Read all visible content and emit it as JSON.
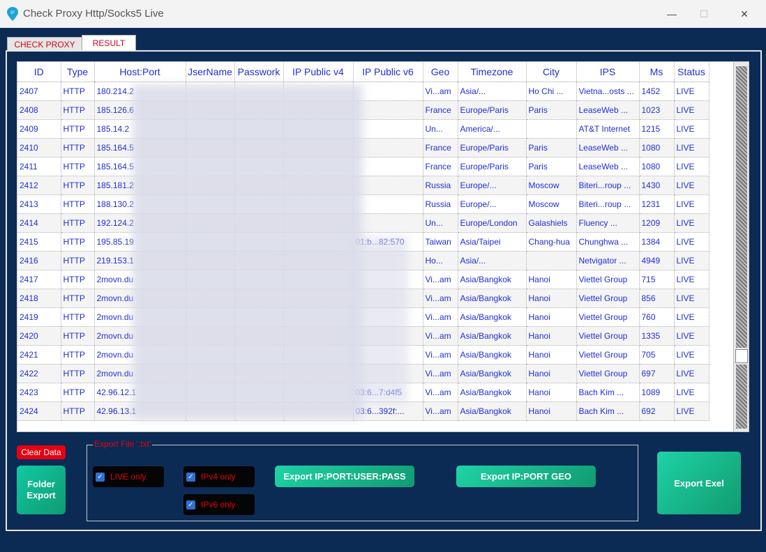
{
  "window": {
    "title": "Check Proxy Http/Socks5 Live",
    "icon": "location-pin-icon",
    "minimize": "—",
    "maximize": "☐",
    "close": "✕"
  },
  "tabs": [
    {
      "label": "CHECK PROXY"
    },
    {
      "label": "RESULT",
      "active": true
    }
  ],
  "table": {
    "columns": [
      "ID",
      "Type",
      "Host:Port",
      "JserName",
      "Passwork",
      "IP Public v4",
      "IP Public v6",
      "Geo",
      "Timezone",
      "City",
      "IPS",
      "Ms",
      "Status"
    ],
    "rows": [
      [
        "2407",
        "HTTP",
        "180.214.2",
        "",
        "",
        "",
        "",
        "Vi...am",
        "Asia/...",
        "Ho Chi ...",
        "Vietna...osts ...",
        "1452",
        "LIVE"
      ],
      [
        "2408",
        "HTTP",
        "185.126.6",
        "",
        "",
        "",
        "",
        "France",
        "Europe/Paris",
        "Paris",
        "LeaseWeb ...",
        "1023",
        "LIVE"
      ],
      [
        "2409",
        "HTTP",
        "185.14.2",
        "",
        "",
        "",
        "",
        "Un...",
        "America/...",
        "",
        "AT&T Internet",
        "1215",
        "LIVE"
      ],
      [
        "2410",
        "HTTP",
        "185.164.5",
        "",
        "",
        "",
        "",
        "France",
        "Europe/Paris",
        "Paris",
        "LeaseWeb ...",
        "1080",
        "LIVE"
      ],
      [
        "2411",
        "HTTP",
        "185.164.5",
        "",
        "",
        "",
        "",
        "France",
        "Europe/Paris",
        "Paris",
        "LeaseWeb ...",
        "1080",
        "LIVE"
      ],
      [
        "2412",
        "HTTP",
        "185.181.2",
        "",
        "",
        "",
        "",
        "Russia",
        "Europe/...",
        "Moscow",
        "Biteri...roup ...",
        "1430",
        "LIVE"
      ],
      [
        "2413",
        "HTTP",
        "188.130.2",
        "",
        "",
        "",
        "",
        "Russia",
        "Europe/...",
        "Moscow",
        "Biteri...roup ...",
        "1231",
        "LIVE"
      ],
      [
        "2414",
        "HTTP",
        "192.124.2",
        "",
        "",
        "",
        "",
        "Un...",
        "Europe/London",
        "Galashiels",
        "Fluency ...",
        "1209",
        "LIVE"
      ],
      [
        "2415",
        "HTTP",
        "195.85.19",
        "",
        "",
        "",
        "01:b...82:570",
        "Taiwan",
        "Asia/Taipei",
        "Chang-hua",
        "Chunghwa ...",
        "1384",
        "LIVE"
      ],
      [
        "2416",
        "HTTP",
        "219.153.1",
        "",
        "",
        "",
        "",
        "Ho...",
        "Asia/...",
        "",
        "Netvigator ...",
        "4949",
        "LIVE"
      ],
      [
        "2417",
        "HTTP",
        "2movn.du",
        "",
        "",
        "",
        "",
        "Vi...am",
        "Asia/Bangkok",
        "Hanoi",
        "Viettel Group",
        "715",
        "LIVE"
      ],
      [
        "2418",
        "HTTP",
        "2movn.du",
        "",
        "",
        "",
        "",
        "Vi...am",
        "Asia/Bangkok",
        "Hanoi",
        "Viettel Group",
        "856",
        "LIVE"
      ],
      [
        "2419",
        "HTTP",
        "2movn.du",
        "",
        "",
        "",
        "",
        "Vi...am",
        "Asia/Bangkok",
        "Hanoi",
        "Viettel Group",
        "760",
        "LIVE"
      ],
      [
        "2420",
        "HTTP",
        "2movn.du",
        "",
        "",
        "",
        "",
        "Vi...am",
        "Asia/Bangkok",
        "Hanoi",
        "Viettel Group",
        "1335",
        "LIVE"
      ],
      [
        "2421",
        "HTTP",
        "2movn.du",
        "",
        "",
        "",
        "",
        "Vi...am",
        "Asia/Bangkok",
        "Hanoi",
        "Viettel Group",
        "705",
        "LIVE"
      ],
      [
        "2422",
        "HTTP",
        "2movn.du",
        "",
        "",
        "",
        "",
        "Vi...am",
        "Asia/Bangkok",
        "Hanoi",
        "Viettel Group",
        "697",
        "LIVE"
      ],
      [
        "2423",
        "HTTP",
        "42.96.12.1",
        "",
        "",
        "",
        "03:6...7:d4f5",
        "Vi...am",
        "Asia/Bangkok",
        "Hanoi",
        "Bach Kim ...",
        "1089",
        "LIVE"
      ],
      [
        "2424",
        "HTTP",
        "42.96.13.1",
        "",
        "",
        "",
        "03:6...392f:...",
        "Vi...am",
        "Asia/Bangkok",
        "Hanoi",
        "Bach Kim ...",
        "692",
        "LIVE"
      ]
    ]
  },
  "buttons": {
    "clear": "Clear Data",
    "folder_export": "Folder\nExport",
    "export_user_pass": "Export IP:PORT:USER:PASS",
    "export_geo": "Export IP:PORT GEO",
    "export_excel": "Export Exel"
  },
  "export_group": {
    "label": "Export File '.txt'",
    "live_only": "LIVE only",
    "ipv4_only": "IPv4 only",
    "ipv6_only": "IPv6 only",
    "live_checked": true,
    "ipv4_checked": true,
    "ipv6_checked": true
  },
  "colors": {
    "background": "#0b2b55",
    "grid_text": "#1f2fd6",
    "accent_red": "#e60012",
    "button_green": "#119b70"
  }
}
